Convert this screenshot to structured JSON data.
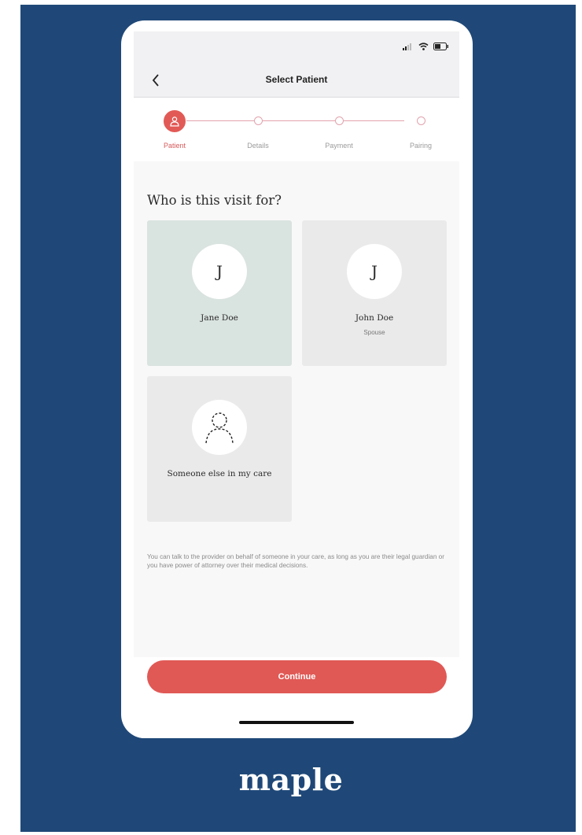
{
  "header": {
    "title": "Select Patient",
    "back_icon": "chevron-left-icon"
  },
  "status_bar": {
    "icons": [
      "cellular-signal-icon",
      "wifi-icon",
      "battery-icon"
    ]
  },
  "stepper": {
    "steps": [
      {
        "label": "Patient",
        "state": "active",
        "icon": "person-icon"
      },
      {
        "label": "Details",
        "state": "upcoming"
      },
      {
        "label": "Payment",
        "state": "upcoming"
      },
      {
        "label": "Pairing",
        "state": "upcoming"
      }
    ]
  },
  "main": {
    "heading": "Who is this visit for?",
    "patients": [
      {
        "initial": "J",
        "name": "Jane Doe",
        "relation": "",
        "selected": true
      },
      {
        "initial": "J",
        "name": "John Doe",
        "relation": "Spouse",
        "selected": false
      }
    ],
    "other_option": {
      "label": "Someone else in my care",
      "icon": "person-dashed-icon"
    },
    "note": "You can talk to the provider on behalf of someone in your care, as long as you are their legal guardian or you have power of attorney over their medical decisions."
  },
  "footer": {
    "continue_label": "Continue"
  },
  "brand": {
    "name": "maple"
  },
  "colors": {
    "background": "#1f4878",
    "accent": "#e05955",
    "selected_card": "#d9e3df",
    "card": "#ebeaeb"
  }
}
